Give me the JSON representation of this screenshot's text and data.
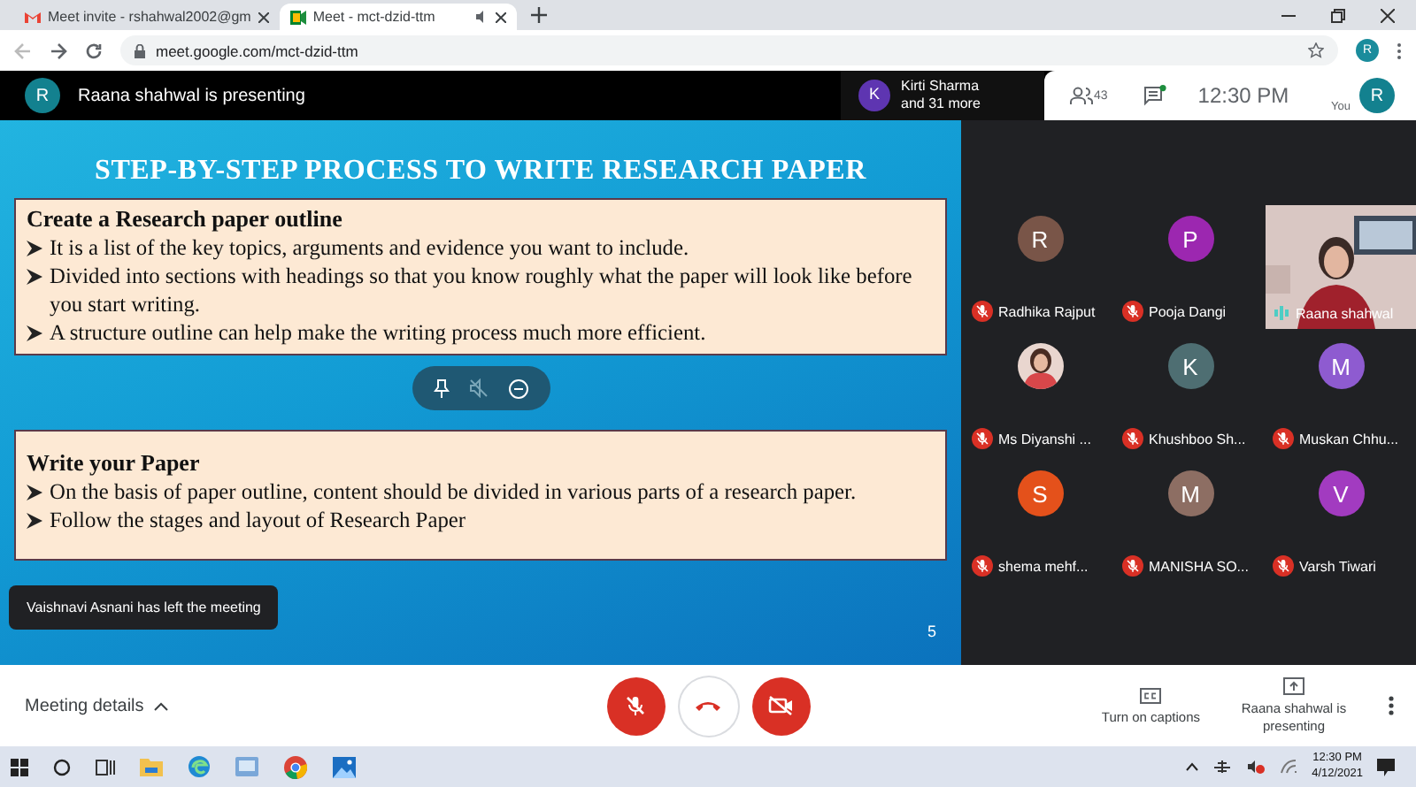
{
  "browser": {
    "tabs": [
      {
        "title": "Meet invite - rshahwal2002@gm",
        "selected": false
      },
      {
        "title": "Meet - mct-dzid-ttm",
        "selected": true
      }
    ],
    "url": "meet.google.com/mct-dzid-ttm",
    "profile_initial": "R"
  },
  "top_bar": {
    "presenter": {
      "initial": "R",
      "text": "Raana shahwal is presenting"
    },
    "others": {
      "initial": "K",
      "name": "Kirti Sharma",
      "more": "and 31 more"
    },
    "participant_count": "43",
    "time": "12:30 PM",
    "self": {
      "initial": "R",
      "label": "You"
    }
  },
  "slide": {
    "title": "STEP-BY-STEP PROCESS TO WRITE RESEARCH PAPER",
    "sections": [
      {
        "heading": "Create a Research paper outline",
        "bullets": [
          "It is a list of the key topics, arguments and evidence you want to include.",
          "Divided into sections with headings so that you know roughly what the paper will look like before you start writing.",
          "A structure outline can help make the writing process much more efficient."
        ]
      },
      {
        "heading": "Write your Paper",
        "bullets": [
          "On the basis of paper outline, content should be divided in various parts of a research paper.",
          "Follow the stages and layout of Research Paper"
        ]
      }
    ],
    "page": "5"
  },
  "toast": "Vaishnavi Asnani has left the meeting",
  "tiles": [
    {
      "kind": "avatar",
      "initial": "R",
      "color": "#795548",
      "name": "Radhika Rajput",
      "muted": true
    },
    {
      "kind": "avatar",
      "initial": "P",
      "color": "#9c27b0",
      "name": "Pooja Dangi",
      "muted": true
    },
    {
      "kind": "video",
      "name": "Raana shahwal",
      "muted": false
    },
    {
      "name": "Ms Diyanshi ...",
      "muted": true
    },
    {
      "kind": "avatar",
      "initial": "K",
      "color": "#4e6e72",
      "name": "Khushboo Sh...",
      "muted": true
    },
    {
      "kind": "avatar",
      "initial": "M",
      "color": "#8e5bd0",
      "name": "Muskan Chhu...",
      "muted": true
    },
    {
      "kind": "avatar",
      "initial": "S",
      "color": "#e4511b",
      "name": "shema mehf...",
      "muted": true
    },
    {
      "kind": "avatar",
      "initial": "M",
      "color": "#8d6e63",
      "name": "MANISHA SO...",
      "muted": true
    },
    {
      "kind": "avatar",
      "initial": "V",
      "color": "#a23bc0",
      "name": "Varsh Tiwari",
      "muted": true
    }
  ],
  "bottom_bar": {
    "meeting_details": "Meeting details",
    "mic_on": false,
    "camera_on": false,
    "captions": "Turn on captions",
    "presenting": "Raana shahwal is presenting"
  },
  "taskbar": {
    "time": "12:30 PM",
    "date": "4/12/2021"
  }
}
